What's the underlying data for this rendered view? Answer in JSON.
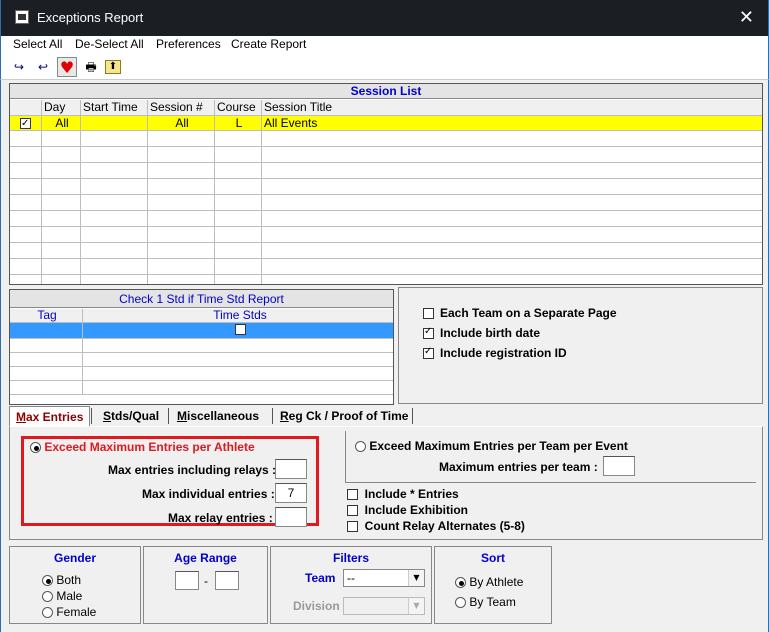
{
  "window": {
    "title": "Exceptions Report",
    "close_glyph": "✕"
  },
  "menu": [
    "Select All",
    "De-Select All",
    "Preferences",
    "Create Report"
  ],
  "toolbar": {
    "redo_icon": "↪",
    "undo_icon": "↩",
    "heart_icon": "♥",
    "print_icon": "🖶",
    "folder_icon": "⬆"
  },
  "session_list": {
    "title": "Session List",
    "columns": [
      "",
      "Day",
      "Start Time",
      "Session #",
      "Course",
      "Session Title"
    ],
    "rows": [
      {
        "checked": true,
        "day": "All",
        "start_time": "",
        "session": "All",
        "course": "L",
        "title": "All Events"
      }
    ]
  },
  "std_report": {
    "title": "Check 1 Std if Time Std Report",
    "columns": [
      "Tag",
      "Time Stds"
    ]
  },
  "options": [
    {
      "label": "Each Team on a Separate Page",
      "checked": false
    },
    {
      "label": "Include birth date",
      "checked": true
    },
    {
      "label": "Include registration ID",
      "checked": true
    }
  ],
  "tabs": [
    {
      "label": "Max Entries",
      "underline": "M",
      "rest": "ax Entries"
    },
    {
      "label": "Stds/Qual",
      "underline": "S",
      "rest": "tds/Qual"
    },
    {
      "label": "Miscellaneous",
      "underline": "M",
      "rest": "iscellaneous"
    },
    {
      "label": "Reg Ck / Proof of Time",
      "underline": "R",
      "rest": "eg Ck / Proof of Time"
    }
  ],
  "max_entries": {
    "athlete_radio": "Exceed Maximum Entries per Athlete",
    "relays_label": "Max entries including relays :",
    "relays_value": "",
    "individual_label": "Max individual entries :",
    "individual_value": "7",
    "relay_label": "Max relay entries :",
    "relay_value": "",
    "team_radio": "Exceed Maximum Entries per Team per Event",
    "team_label": "Maximum entries per team :",
    "team_value": "",
    "include_entries": "Include * Entries",
    "include_exhibition": "Include Exhibition",
    "count_relay": "Count Relay Alternates (5-8)"
  },
  "gender": {
    "title": "Gender",
    "options": [
      "Both",
      "Male",
      "Female"
    ]
  },
  "age_range": {
    "title": "Age Range",
    "separator": "-"
  },
  "filters": {
    "title": "Filters",
    "team_label": "Team",
    "team_value": "--",
    "division_label": "Division",
    "division_value": ""
  },
  "sort": {
    "title": "Sort",
    "options": [
      "By Athlete",
      "By Team"
    ]
  }
}
